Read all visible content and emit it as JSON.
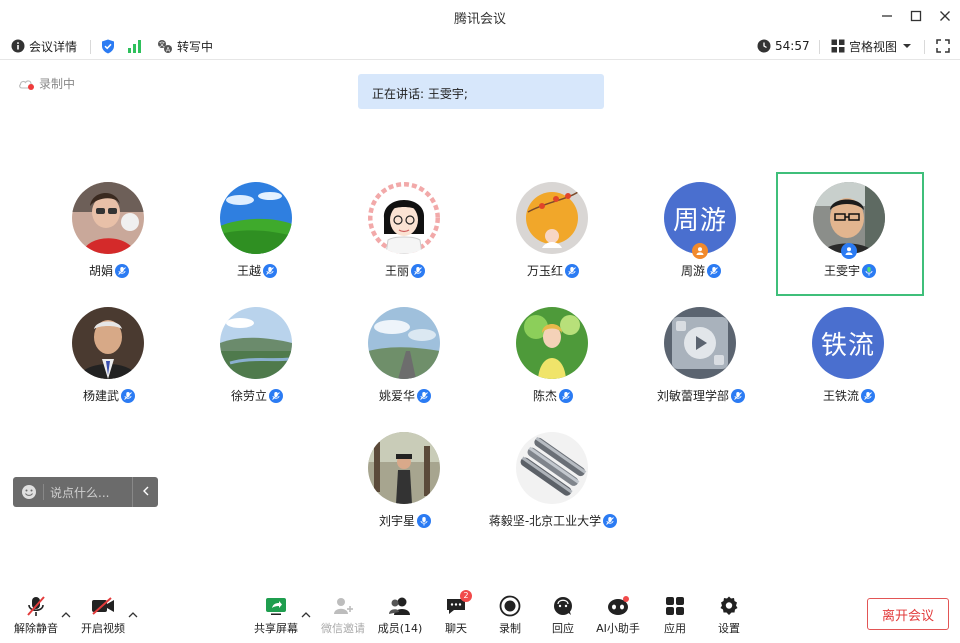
{
  "window": {
    "title": "腾讯会议"
  },
  "toolbar": {
    "meeting_details": "会议详情",
    "transcribing": "转写中",
    "timer": "54:57",
    "view_mode": "宫格视图"
  },
  "recording": {
    "label": "录制中"
  },
  "speaking": {
    "text": "正在讲话: 王雯宇;"
  },
  "participants": [
    {
      "name": "胡娟"
    },
    {
      "name": "王越"
    },
    {
      "name": "王丽"
    },
    {
      "name": "万玉红"
    },
    {
      "name": "周游",
      "avatar_text": "周游"
    },
    {
      "name": "王雯宇"
    },
    {
      "name": "杨建武"
    },
    {
      "name": "徐劳立"
    },
    {
      "name": "姚爱华"
    },
    {
      "name": "陈杰"
    },
    {
      "name": "刘敏蕾理学部"
    },
    {
      "name": "王铁流",
      "avatar_text": "铁流"
    },
    {
      "name": "刘宇星"
    },
    {
      "name": "蒋毅坚-北京工业大学"
    }
  ],
  "chat": {
    "placeholder": "说点什么..."
  },
  "bottom": {
    "unmute": "解除静音",
    "start_video": "开启视频",
    "share_screen": "共享屏幕",
    "wechat_invite": "微信邀请",
    "members": "成员(14)",
    "chat": "聊天",
    "chat_badge": "2",
    "record": "录制",
    "applause": "回应",
    "ai_assistant": "AI小助手",
    "apps": "应用",
    "settings": "设置",
    "leave": "离开会议"
  },
  "colors": {
    "accent": "#2b7bf3",
    "active_border": "#3fbf7a",
    "leave": "#e23b3b"
  }
}
